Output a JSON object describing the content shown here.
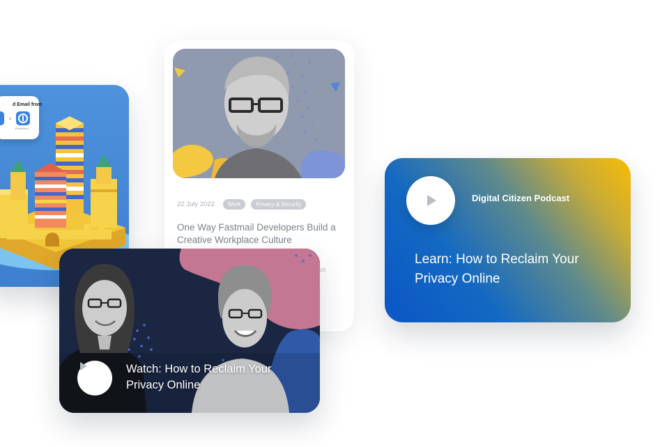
{
  "city_card": {
    "popup_title": "d Email from",
    "popup_app_label": "1Password"
  },
  "article_card": {
    "date": "22 July 2022",
    "tags": [
      "Work",
      "Privacy & Security"
    ],
    "title": "One Way Fastmail Developers Build a Creative Workplace Culture",
    "excerpt_fragments": [
      "pibus",
      "get"
    ]
  },
  "watch_card": {
    "title": "Watch: How to Reclaim Your Privacy Online",
    "play_icon": "play-icon"
  },
  "podcast_card": {
    "name": "Digital Citizen Podcast",
    "title": "Learn: How to Reclaim Your Privacy Online",
    "play_icon": "play-icon"
  },
  "colors": {
    "podcast_gradient_start": "#0a56c6",
    "podcast_gradient_end": "#f9bc07",
    "watch_background": "#1a2540",
    "city_background": "#4d8fd6"
  }
}
